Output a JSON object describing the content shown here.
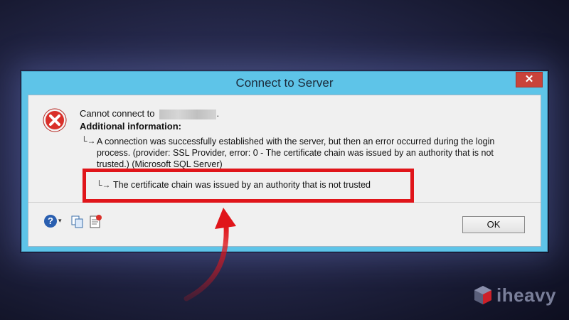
{
  "window": {
    "title": "Connect to Server",
    "close_glyph": "✕"
  },
  "message": {
    "cannot_connect": "Cannot connect to",
    "server_redacted_suffix": ".",
    "additional_info_label": "Additional information:",
    "detail_text": "A connection was successfully established with the server, but then an error occurred during the login process. (provider: SSL Provider, error: 0 - The certificate chain was issued by an authority that is not trusted.) (Microsoft SQL Server)",
    "highlighted_text": "The certificate chain was issued by an authority that is not trusted"
  },
  "footer": {
    "help_glyph": "?",
    "dropdown_glyph": "▾",
    "ok_label": "OK"
  },
  "icons": {
    "error": "error-icon",
    "help": "help-icon",
    "copy": "copy-icon",
    "copy_message": "copy-message-icon"
  },
  "branding": {
    "logo_text": "iheavy"
  },
  "colors": {
    "title_bar": "#5ec4e8",
    "client_bg": "#f0f0f0",
    "highlight": "#e0151a",
    "close_button": "#c9433a",
    "error_icon": "#d9302a"
  }
}
